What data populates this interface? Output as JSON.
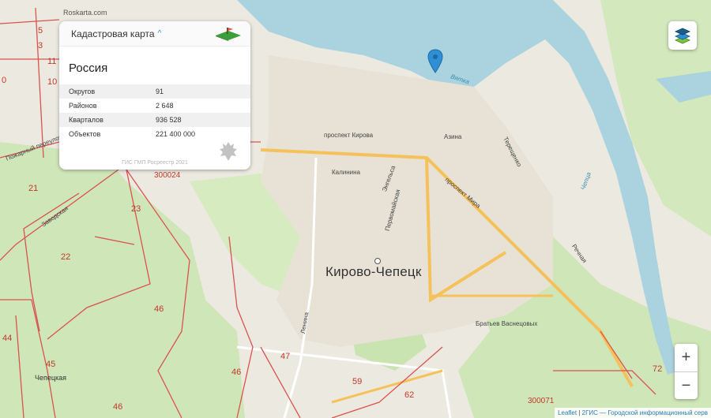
{
  "site_brand": "Roskarta.com",
  "panel": {
    "title": "Кадастровая карта",
    "region": "Россия",
    "stats": [
      {
        "label": "Округов",
        "value": "91"
      },
      {
        "label": "Районов",
        "value": "2 648"
      },
      {
        "label": "Кварталов",
        "value": "936 528"
      },
      {
        "label": "Объектов",
        "value": "221 400 000"
      }
    ],
    "footer": "ГИС ГМП Росреестр 2021"
  },
  "map": {
    "city": "Кирово-Чепецк",
    "streets": [
      "проспект Кирова",
      "Азина",
      "Терещенко",
      "Калинина",
      "Энгельса",
      "проспект Мира",
      "Первомайская",
      "Ленина",
      "Братьев Васнецовых",
      "Речная",
      "Заводская",
      "Пожарный переулок"
    ],
    "rivers": [
      "Вятка",
      "Чепца"
    ],
    "parcels": [
      "5",
      "3",
      "11",
      "10",
      "0",
      "21",
      "23",
      "22",
      "46",
      "45",
      "44",
      "46",
      "47",
      "59",
      "62",
      "72",
      "46"
    ],
    "parcel_codes": [
      "300024",
      "300071"
    ],
    "stations": [
      "Чепецкая"
    ],
    "colors": {
      "water": "#aad3df",
      "green": "#cfe6b8",
      "road": "#f5c15a",
      "boundary": "#d9534f"
    }
  },
  "controls": {
    "layers_icon": "layers-icon",
    "zoom_in": "+",
    "zoom_out": "−"
  },
  "attribution": {
    "leaflet": "Leaflet",
    "separator": " | ",
    "source": "2ГИС — Городской информационный серв"
  }
}
